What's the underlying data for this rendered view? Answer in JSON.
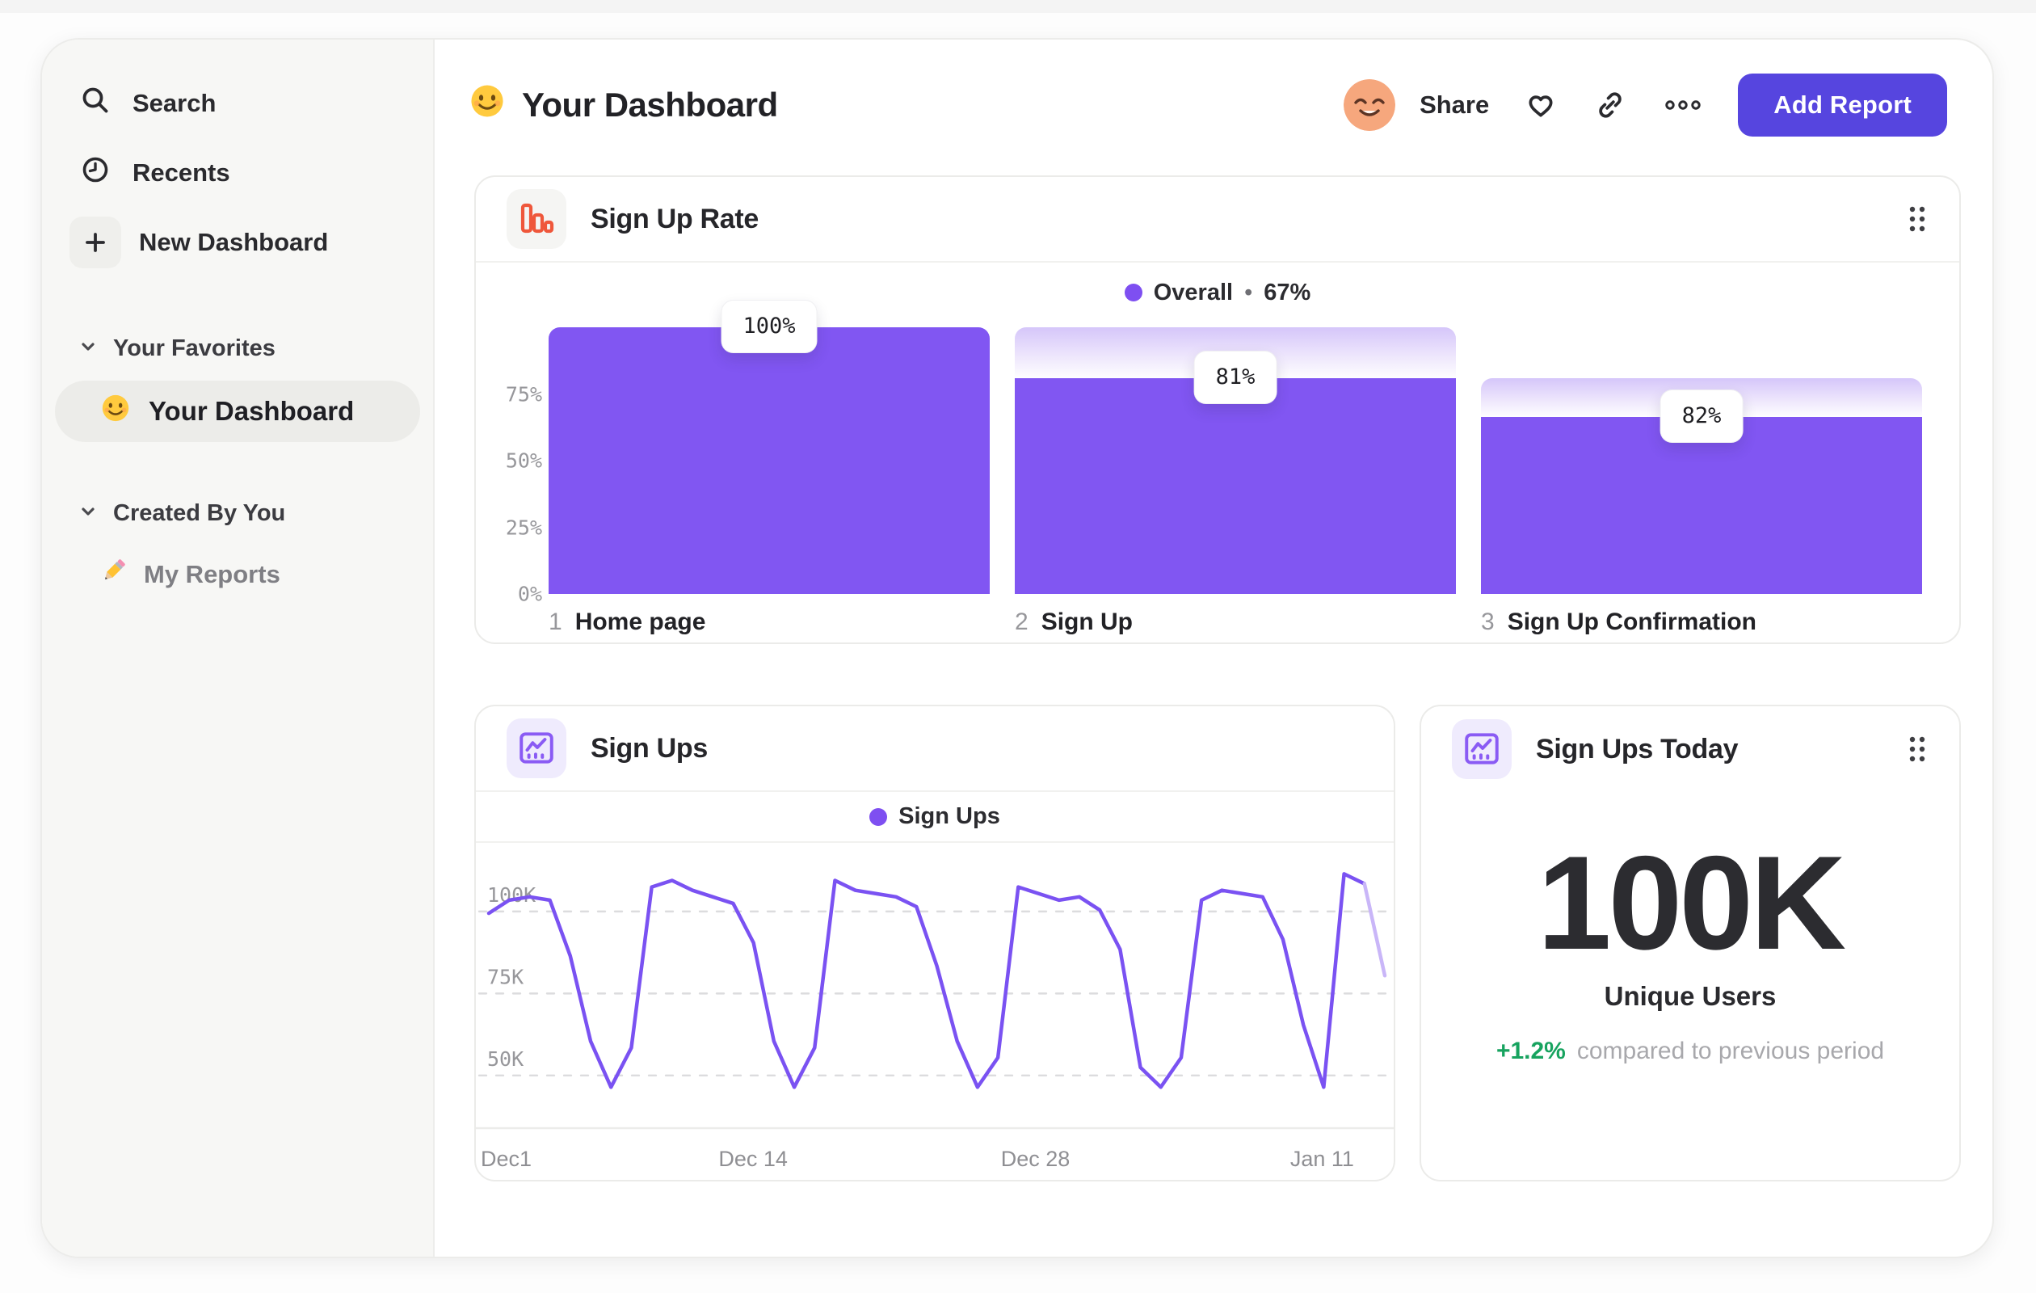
{
  "header": {
    "title": "Your Dashboard",
    "share_label": "Share",
    "add_report_label": "Add Report"
  },
  "sidebar": {
    "items": [
      {
        "label": "Search",
        "icon": "search-icon"
      },
      {
        "label": "Recents",
        "icon": "clock-icon"
      },
      {
        "label": "New Dashboard",
        "icon": "plus-icon"
      }
    ],
    "sections": [
      {
        "label": "Your Favorites",
        "items": [
          {
            "label": "Your Dashboard",
            "icon": "smiley-emoji",
            "selected": true
          }
        ]
      },
      {
        "label": "Created By You",
        "items": [
          {
            "label": "My Reports",
            "icon": "pencil-emoji",
            "selected": false
          }
        ]
      }
    ]
  },
  "cards": {
    "funnel": {
      "title": "Sign Up Rate",
      "legend": {
        "label": "Overall",
        "separator": "•",
        "value": "67%"
      },
      "steps": [
        {
          "index": "1",
          "label": "Home page"
        },
        {
          "index": "2",
          "label": "Sign Up"
        },
        {
          "index": "3",
          "label": "Sign Up Confirmation"
        }
      ]
    },
    "line": {
      "title": "Sign Ups",
      "legend": {
        "label": "Sign Ups"
      }
    },
    "kpi": {
      "title": "Sign Ups Today",
      "value": "100K",
      "value_label": "Unique Users",
      "delta": "+1.2%",
      "delta_caption": "compared to previous period"
    }
  },
  "chart_data": [
    {
      "id": "signup_rate_funnel",
      "type": "bar",
      "title": "Sign Up Rate",
      "legend": "Overall • 67%",
      "categories": [
        "1 Home page",
        "2 Sign Up",
        "3 Sign Up Confirmation"
      ],
      "step_conversion_pct": [
        100,
        81,
        82
      ],
      "absolute_pct": [
        100,
        81,
        66.4
      ],
      "value_labels": [
        "100%",
        "81%",
        "82%"
      ],
      "y_ticks": [
        {
          "value": 75,
          "label": "75%"
        },
        {
          "value": 50,
          "label": "50%"
        },
        {
          "value": 25,
          "label": "25%"
        },
        {
          "value": 0,
          "label": "0%"
        }
      ],
      "ylim": [
        0,
        100
      ],
      "bar_color": "#8156F2",
      "fade_top_color": "#D5C6FA",
      "legend_position": "top-center",
      "grid": false
    },
    {
      "id": "sign_ups_line",
      "type": "line",
      "title": "Sign Ups",
      "series": [
        {
          "name": "Sign Ups",
          "values": [
            96,
            100,
            101,
            100,
            83,
            57,
            43,
            55,
            104,
            106,
            103,
            101,
            99,
            87,
            57,
            43,
            55,
            106,
            103,
            102,
            101,
            98,
            80,
            57,
            43,
            52,
            104,
            102,
            100,
            101,
            97,
            85,
            49,
            43,
            52,
            100,
            103,
            102,
            101,
            88,
            62,
            43,
            108,
            105,
            77
          ]
        }
      ],
      "unit": "K",
      "x_tick_labels": [
        "Dec1",
        "Dec 14",
        "Dec 28",
        "Jan 11"
      ],
      "x_tick_positions": [
        0.0,
        0.295,
        0.61,
        0.93
      ],
      "y_gridlines": [
        100,
        75,
        50
      ],
      "y_tick_labels": [
        "100K",
        "75K",
        "50K"
      ],
      "ylim": [
        31,
        114.5
      ],
      "line_color": "#7A52F2",
      "partial_segment_color": "#C9B6F8",
      "partial_last_segment": true,
      "legend_position": "top-center",
      "grid": "dashed-horizontal"
    }
  ]
}
